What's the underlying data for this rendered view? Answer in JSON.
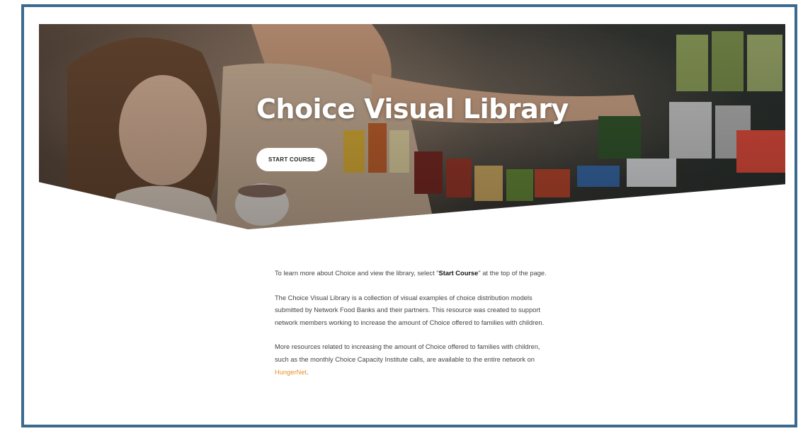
{
  "hero": {
    "title": "Choice Visual Library",
    "button_label": "START COURSE"
  },
  "intro": {
    "part1": "To learn more about Choice and view the library, select \"",
    "bold": "Start Course",
    "part2": "\" at the top of the page."
  },
  "about": {
    "text": "The Choice Visual Library is a collection of visual examples of choice distribution models submitted by Network Food Banks and their partners. This resource was created to support network members working to increase the amount of Choice offered to families with children."
  },
  "resources": {
    "text": "More resources related to increasing the amount of Choice offered to families with children, such as the monthly Choice Capacity Institute calls, are available to the entire network on ",
    "link_label": "HungerNet",
    "end": "."
  },
  "colors": {
    "frame_border": "#3b6a8e",
    "link": "#e8902c",
    "text": "#444444"
  }
}
